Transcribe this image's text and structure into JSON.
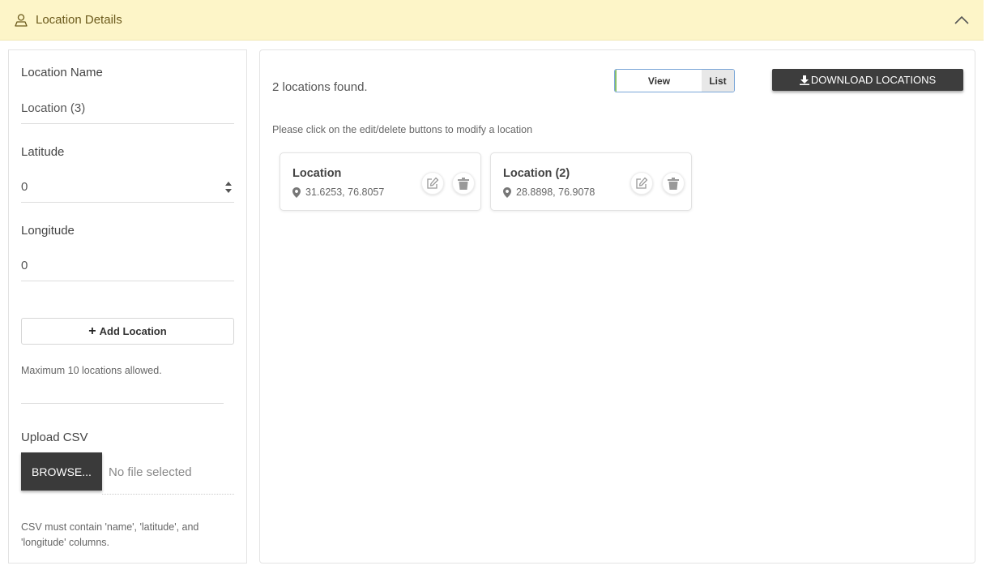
{
  "header": {
    "title": "Location Details",
    "icon": "person-icon",
    "collapse_icon": "chevron-up-icon",
    "background": "#fdf5c8"
  },
  "form": {
    "location_name_label": "Location Name",
    "location_name_value": "Location (3)",
    "latitude_label": "Latitude",
    "latitude_value": "0",
    "longitude_label": "Longitude",
    "longitude_value": "0",
    "add_button_label": "Add Location",
    "max_note": "Maximum 10 locations allowed.",
    "upload_label": "Upload CSV",
    "browse_label": "BROWSE...",
    "file_status": "No file selected",
    "csv_note_line1": "CSV must contain 'name', 'latitude', and",
    "csv_note_line2": "'longitude' columns."
  },
  "results": {
    "found_text": "2 locations found.",
    "toggle": {
      "view_label": "View",
      "list_label": "List"
    },
    "download_label": "DOWNLOAD LOCATIONS",
    "hint": "Please click on the edit/delete buttons to modify a location",
    "locations": [
      {
        "name": "Location",
        "coords": "31.6253, 76.8057"
      },
      {
        "name": "Location (2)",
        "coords": "28.8898, 76.9078"
      }
    ]
  }
}
